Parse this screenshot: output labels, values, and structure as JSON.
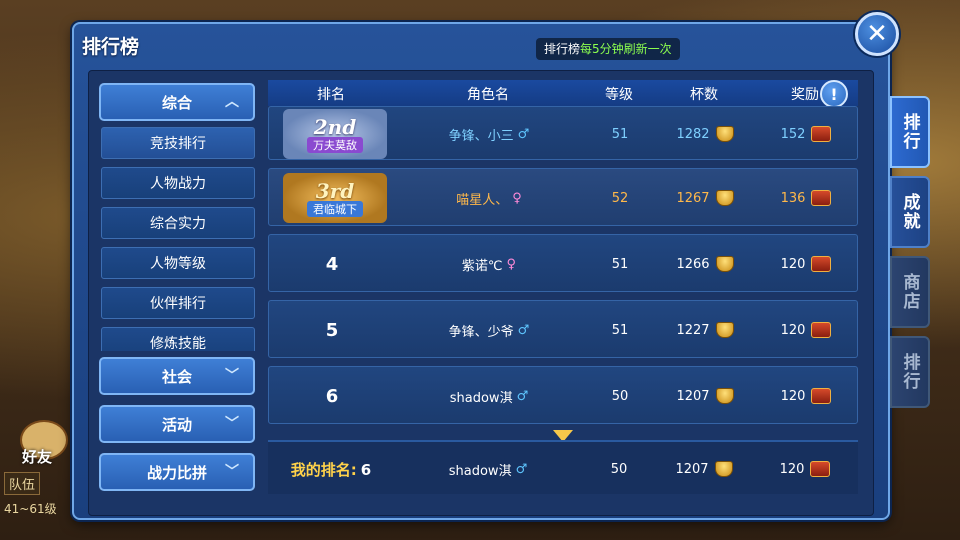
{
  "panel": {
    "title": "排行榜",
    "refresh_prefix": "排行榜",
    "refresh_highlight": "每5分钟刷新一次"
  },
  "close_icon": "close-icon",
  "menu": {
    "main_label": "综合",
    "sub_items": [
      "竞技排行",
      "人物战力",
      "综合实力",
      "人物等级",
      "伙伴排行",
      "修炼技能"
    ],
    "social_label": "社会",
    "activity_label": "活动",
    "power_label": "战力比拼"
  },
  "table": {
    "headers": {
      "rank": "排名",
      "name": "角色名",
      "level": "等级",
      "cups": "杯数",
      "reward": "奖励"
    },
    "rows": [
      {
        "rank_badge": "2nd",
        "badge_title": "万夫莫敌",
        "name": "争锋、小三",
        "gender": "♂",
        "level": "51",
        "cups": "1282",
        "reward": "152"
      },
      {
        "rank_badge": "3rd",
        "badge_title": "君临城下",
        "name": "喵星人、",
        "gender": "♀",
        "level": "52",
        "cups": "1267",
        "reward": "136"
      },
      {
        "rank": "4",
        "name": "紫诺℃",
        "gender": "♀",
        "level": "51",
        "cups": "1266",
        "reward": "120"
      },
      {
        "rank": "5",
        "name": "争锋、少爷",
        "gender": "♂",
        "level": "51",
        "cups": "1227",
        "reward": "120"
      },
      {
        "rank": "6",
        "name": "shadow淇",
        "gender": "♂",
        "level": "50",
        "cups": "1207",
        "reward": "120"
      }
    ],
    "my_rank": {
      "label": "我的排名:",
      "rank": "6",
      "name": "shadow淇",
      "gender": "♂",
      "level": "50",
      "cups": "1207",
      "reward": "120"
    }
  },
  "right_tabs": [
    "排行",
    "成就",
    "商店",
    "排行"
  ],
  "hud": {
    "friend": "好友",
    "team": "队伍",
    "level_range": "41~61级"
  },
  "colors": {
    "panel": "#26539a",
    "accent_green": "#8cff4f",
    "gold": "#ffb84a",
    "silver": "#7fd0ff"
  }
}
